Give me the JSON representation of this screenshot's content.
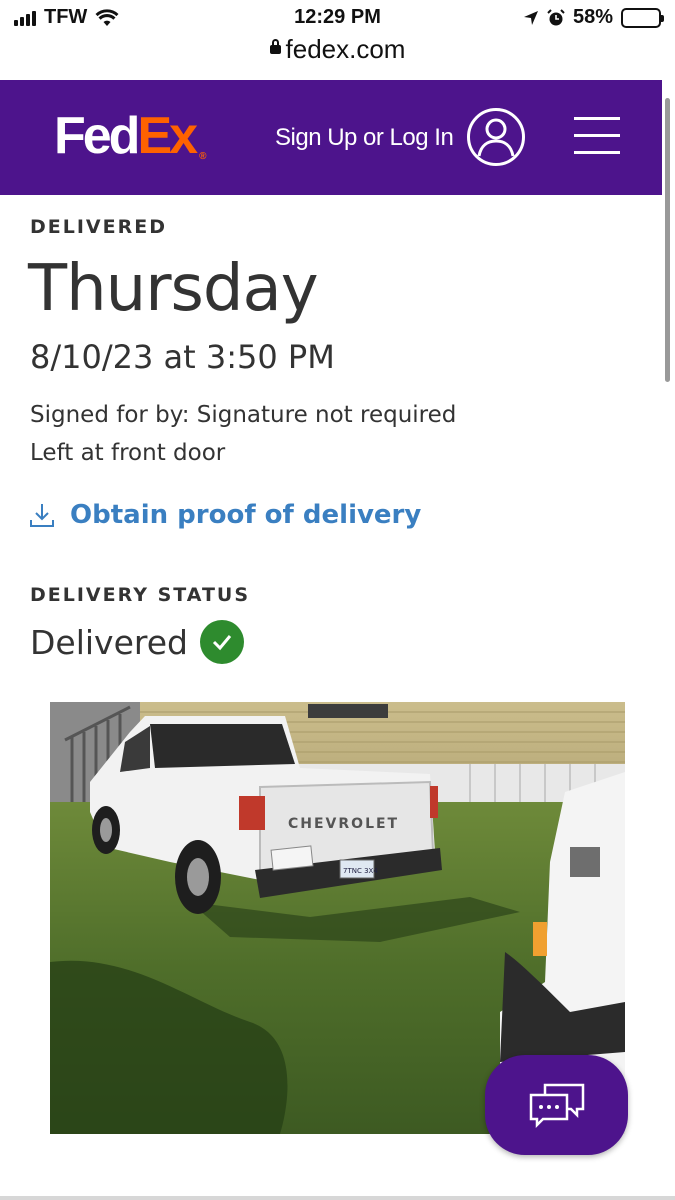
{
  "status_bar": {
    "carrier": "TFW",
    "time": "12:29 PM",
    "battery": "58%",
    "battery_level": 0.58
  },
  "url_bar": {
    "domain": "fedex.com"
  },
  "header": {
    "logo_fed": "Fed",
    "logo_ex": "Ex",
    "logo_mark": "®",
    "signin_label": "Sign Up or Log In",
    "brand_color": "#4d148c",
    "logo_accent": "#ff6200"
  },
  "delivery": {
    "eyebrow": "DELIVERED",
    "day": "Thursday",
    "datetime": "8/10/23 at 3:50 PM",
    "signed_for": "Signed for by: Signature not required",
    "left_at": "Left at front door",
    "proof_link": "Obtain proof of delivery",
    "link_color": "#3a7fc1"
  },
  "status": {
    "heading": "DELIVERY STATUS",
    "value": "Delivered",
    "check_color": "#2e8b2e"
  },
  "photo": {
    "tailgate_text": "CHEVROLET",
    "plate_text": "7TNC 3X4"
  },
  "icons": {
    "user": "user-icon",
    "menu": "hamburger-menu-icon",
    "download": "download-icon",
    "check": "check-circle-icon",
    "chat": "chat-bubbles-icon"
  }
}
